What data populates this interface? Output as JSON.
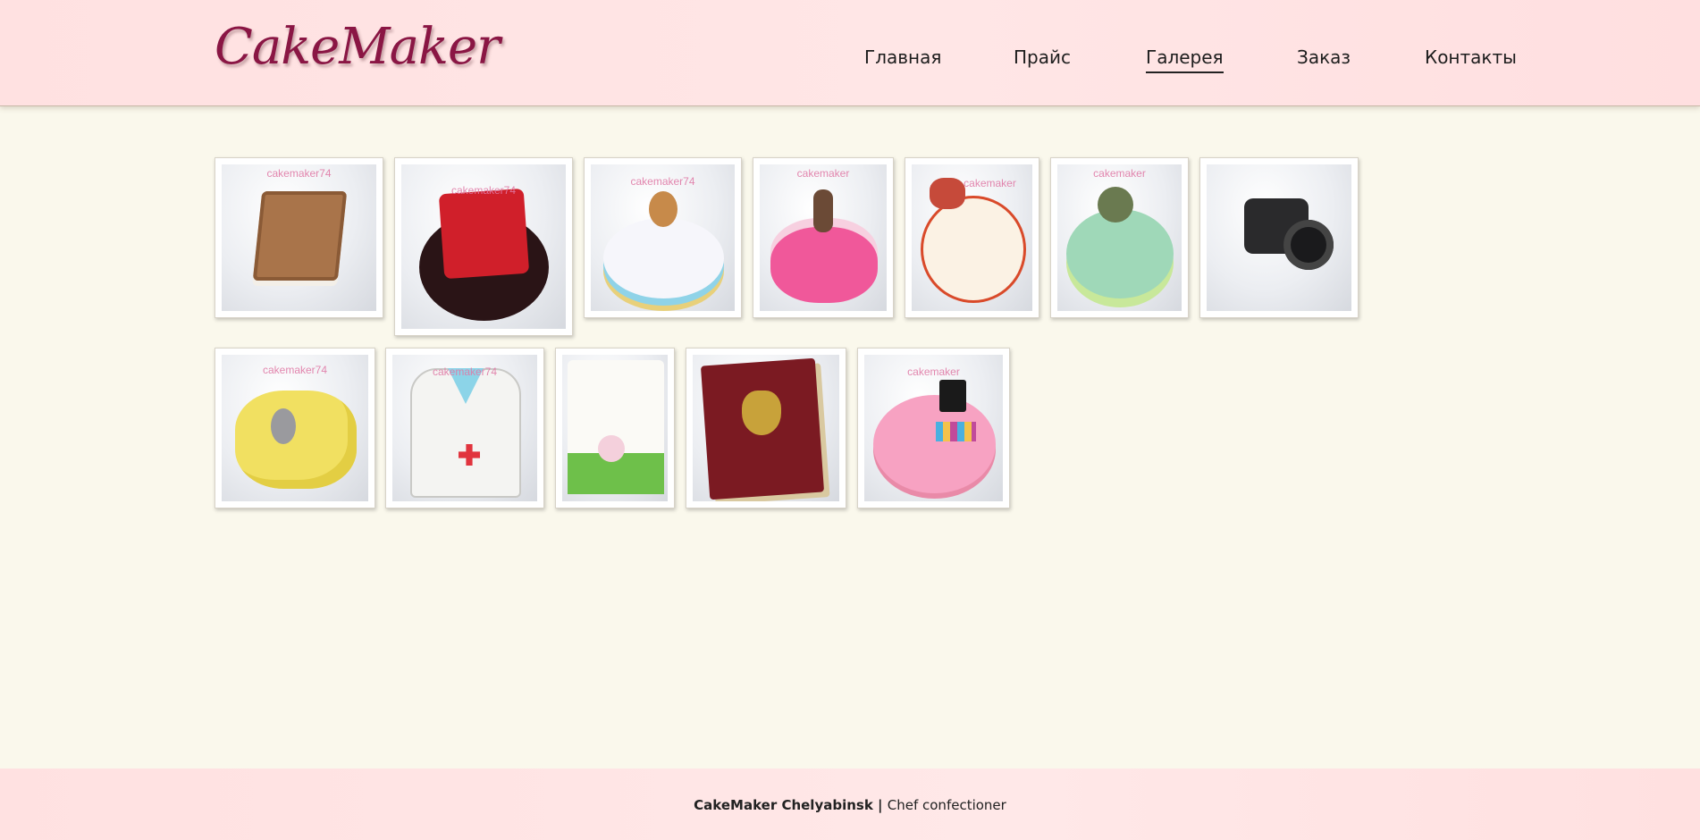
{
  "header": {
    "logo": "CakeMaker",
    "nav": [
      {
        "label": "Главная",
        "name": "nav-home"
      },
      {
        "label": "Прайс",
        "name": "nav-price"
      },
      {
        "label": "Галерея",
        "name": "nav-gallery",
        "active": true
      },
      {
        "label": "Заказ",
        "name": "nav-order"
      },
      {
        "label": "Контакты",
        "name": "nav-contacts"
      }
    ]
  },
  "gallery": {
    "items": [
      {
        "watermark": "cakemaker74",
        "alt": "Cake shaped like a chocolate book",
        "top_color": "#a9744a",
        "base_color": "#f3efe8"
      },
      {
        "watermark": "cakemaker74",
        "alt": "DOTA2 cake",
        "top_color": "#d01f2a",
        "base_color": "#2a1416"
      },
      {
        "watermark": "cakemaker74",
        "alt": "White cake with figure",
        "top_color": "#f6f6fb",
        "base_color": "#8fd3e8"
      },
      {
        "watermark": "cakemaker",
        "alt": "Pink cake with figure and stars",
        "top_color": "#f0589a",
        "base_color": "#f7d0e0"
      },
      {
        "watermark": "cakemaker",
        "alt": "Birthday cake with sweets",
        "top_color": "#fbf2e4",
        "base_color": "#d94a2a"
      },
      {
        "watermark": "cakemaker",
        "alt": "Green fishing cake",
        "top_color": "#9fd8b8",
        "base_color": "#c8e89a"
      },
      {
        "watermark": "",
        "alt": "Camera cake",
        "top_color": "#2a2a2c",
        "base_color": "#f2f2f4"
      },
      {
        "watermark": "cakemaker74",
        "alt": "Cheese cake with mice",
        "top_color": "#f1e061",
        "base_color": "#e3ce43"
      },
      {
        "watermark": "cakemaker74",
        "alt": "Doctor coat cake",
        "top_color": "#f4f4f2",
        "base_color": "#8cd4e8"
      },
      {
        "watermark": "",
        "alt": "Number cake with flowers",
        "top_color": "#fbfaf6",
        "base_color": "#6ec04a"
      },
      {
        "watermark": "",
        "alt": "Russian passport cake",
        "top_color": "#7b1a22",
        "base_color": "#d9c9a0"
      },
      {
        "watermark": "cakemaker",
        "alt": "Makeup cake",
        "top_color": "#f7a2c2",
        "base_color": "#e98aa8"
      }
    ]
  },
  "footer": {
    "brand": "CakeMaker Chelyabinsk",
    "separator": " | ",
    "tagline": "Chef confectioner"
  }
}
